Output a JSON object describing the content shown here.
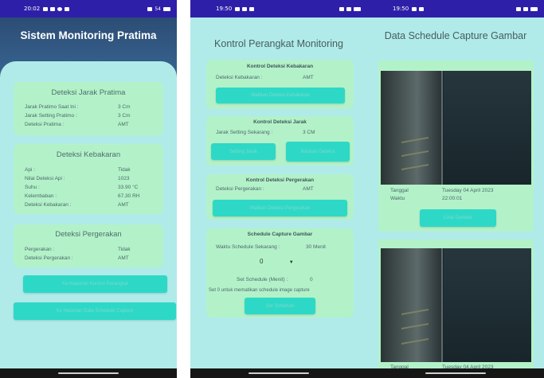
{
  "screen1": {
    "status_time": "20:02",
    "status_right": "54",
    "title": "Sistem Monitoring Pratima",
    "card_jarak": {
      "title": "Deteksi Jarak Pratima",
      "rows": [
        {
          "label": "Jarak Pratimo Saat Ini :",
          "value": "3 Cm"
        },
        {
          "label": "Jarak Setting Pratimo :",
          "value": "3 Cm"
        },
        {
          "label": "Deteksi Pratima :",
          "value": "AMT"
        }
      ]
    },
    "card_kebakaran": {
      "title": "Deteksi Kebakaran",
      "rows": [
        {
          "label": "Api :",
          "value": "Tidak"
        },
        {
          "label": "Nilai Deteksi Api :",
          "value": "1023"
        },
        {
          "label": "Suhu :",
          "value": "33.90 °C"
        },
        {
          "label": "Kelembaban :",
          "value": "67.30 RH"
        },
        {
          "label": "Deteksi Kebakaran :",
          "value": "AMT"
        }
      ]
    },
    "card_pergerakan": {
      "title": "Deteksi Pergerakan",
      "rows": [
        {
          "label": "Pergerakan :",
          "value": "Tidak"
        },
        {
          "label": "Deteksi Pergerakan :",
          "value": "AMT"
        }
      ]
    },
    "button1": "Ke Halaman Kontrol Perangkat",
    "button2": "Ke Halaman Data Schedule Capture"
  },
  "screen2": {
    "status_time": "19:50",
    "title": "Kontrol Perangkat Monitoring",
    "kebakaran": {
      "title": "Kontrol Deteksi Kebakaran",
      "label": "Deteksi Kebakaran :",
      "value": "AMT",
      "button": "Matikan Deteksi Kebakaran"
    },
    "jarak": {
      "title": "Kontrol Deteksi Jarak",
      "label": "Jarak Setting Sekarang :",
      "value": "3 CM",
      "button_left": "Setting Jarak",
      "button_right": "Matikan Deteksi"
    },
    "pergerakan": {
      "title": "Kontrol Deteksi Pergerakan",
      "label": "Deteksi Pergerakan :",
      "value": "AMT",
      "button": "Matikan Deteksi Pergerakan"
    },
    "schedule": {
      "title": "Schedule Capture Gambar",
      "label": "Waktu Schedule Sekarang :",
      "value": "30 Menit",
      "dropdown_value": "0",
      "set_label": "Set Schedule (Menit) :",
      "set_value": "0",
      "hint": "Set 0 untuk mematikan schedule image capture",
      "button": "Set Schedule"
    }
  },
  "screen3": {
    "status_time": "19:50",
    "title": "Data Schedule Capture Gambar",
    "item1": {
      "tanggal_label": "Tanggal",
      "tanggal_value": "Tuesday 04 April 2023",
      "waktu_label": "Waktu",
      "waktu_value": "22:00:01",
      "button": "Lihat Gambar"
    },
    "item2": {
      "tanggal_label": "Tanggal",
      "tanggal_value": "Tuesday 04 April 2023"
    }
  }
}
